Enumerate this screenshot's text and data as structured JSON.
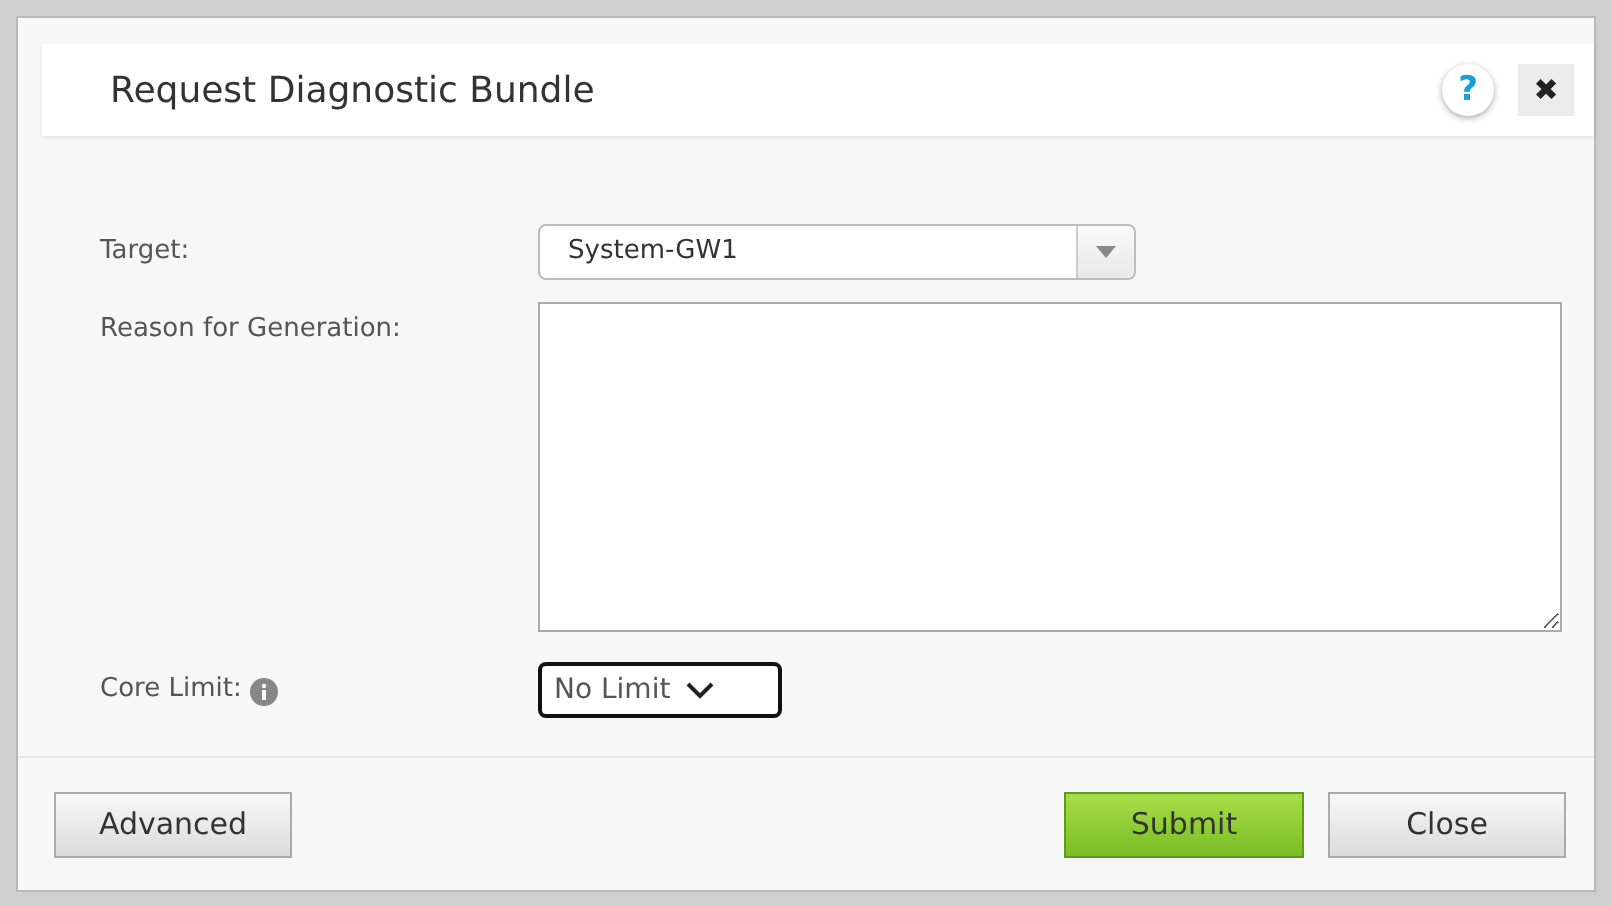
{
  "dialog": {
    "title": "Request Diagnostic Bundle",
    "help": "?",
    "close": "✖"
  },
  "fields": [
    {
      "kind": "select",
      "label": "Target:",
      "value": "System-GW1",
      "info": false
    },
    {
      "kind": "textarea",
      "label": "Reason for Generation:",
      "info": false
    },
    {
      "kind": "native",
      "label": "Core Limit:",
      "value": "No Limit",
      "info": true
    }
  ],
  "buttons": [
    {
      "label": "Advanced",
      "kind": "secondary"
    },
    {
      "label": "Submit",
      "kind": "primary"
    },
    {
      "label": "Close",
      "kind": "secondary"
    }
  ]
}
